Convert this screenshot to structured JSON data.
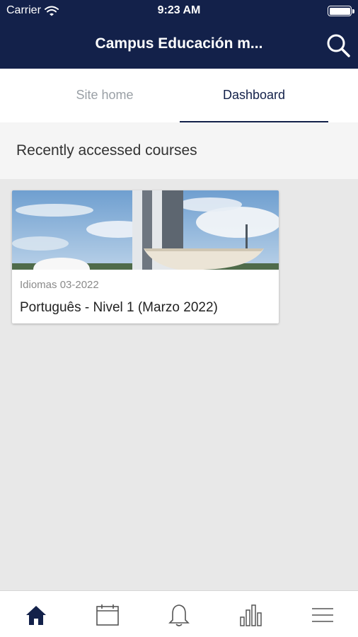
{
  "status_bar": {
    "carrier": "Carrier",
    "time": "9:23 AM",
    "battery_level": 1.0
  },
  "header": {
    "title": "Campus Educación m...",
    "search_icon": "search-icon"
  },
  "tabs": [
    {
      "label": "Site home",
      "active": false
    },
    {
      "label": "Dashboard",
      "active": true
    }
  ],
  "section": {
    "title": "Recently accessed courses"
  },
  "courses": [
    {
      "category": "Idiomas 03-2022",
      "name": "Português - Nivel 1 (Marzo 2022)"
    }
  ],
  "bottom_nav": {
    "items": [
      {
        "icon": "home-icon",
        "active": true
      },
      {
        "icon": "calendar-icon",
        "active": false
      },
      {
        "icon": "bell-icon",
        "active": false
      },
      {
        "icon": "chart-icon",
        "active": false
      },
      {
        "icon": "menu-icon",
        "active": false
      }
    ]
  },
  "colors": {
    "primary": "#13214a",
    "inactive_tab": "#9aa0a6",
    "background": "#e8e8e8"
  }
}
